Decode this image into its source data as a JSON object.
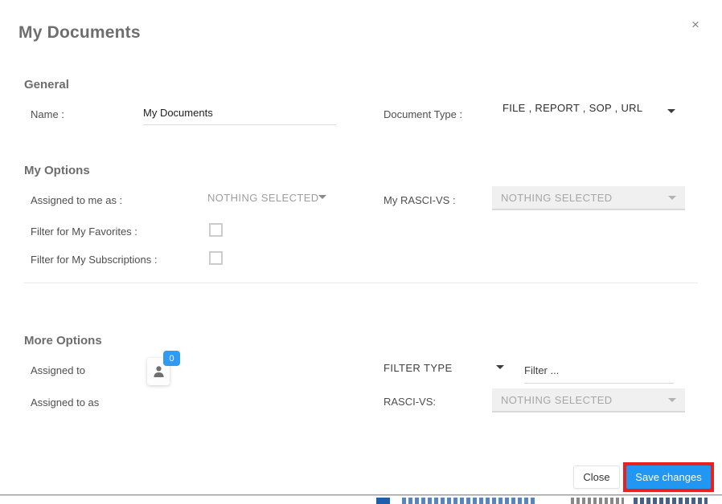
{
  "modal": {
    "title": "My Documents",
    "close_glyph": "×"
  },
  "general": {
    "heading": "General",
    "name_label": "Name :",
    "name_value": "My Documents",
    "document_type_label": "Document Type :",
    "document_type_value": "FILE , REPORT , SOP , URL"
  },
  "my_options": {
    "heading": "My Options",
    "assigned_to_me_label": "Assigned to me as :",
    "assigned_to_me_value": "NOTHING SELECTED",
    "my_rasci_label": "My RASCI-VS :",
    "my_rasci_value": "NOTHING SELECTED",
    "favorites_label": "Filter for My Favorites :",
    "subscriptions_label": "Filter for My Subscriptions :"
  },
  "more_options": {
    "heading": "More Options",
    "assigned_to_label": "Assigned to",
    "assigned_to_count": "0",
    "assigned_to_as_label": "Assigned to as",
    "filter_type_label": "FILTER TYPE",
    "filter_placeholder": "Filter ...",
    "rasci_label": "RASCI-VS:",
    "rasci_value": "NOTHING SELECTED"
  },
  "footer": {
    "close_label": "Close",
    "save_label": "Save changes"
  },
  "colors": {
    "accent_blue": "#2196f3",
    "badge_blue": "#2f9bf2",
    "highlight_red": "#e8211f",
    "heading_gray": "#6d6d6d",
    "disabled_bg": "#f0f0f0"
  }
}
